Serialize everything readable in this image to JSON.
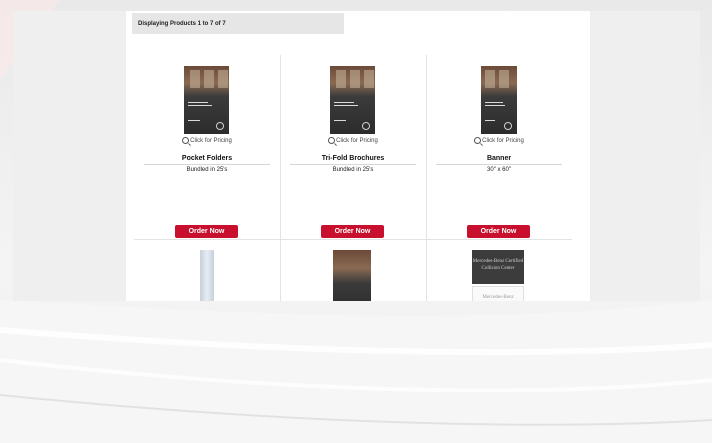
{
  "header": {
    "displaying_text": "Displaying Products 1 to 7 of 7"
  },
  "products": [
    {
      "pricing_label": "Click for Pricing",
      "title": "Pocket Folders",
      "subtitle": "Bundled in 25's",
      "button_label": "Order Now"
    },
    {
      "pricing_label": "Click for Pricing",
      "title": "Tri-Fold Brochures",
      "subtitle": "Bundled in 25's",
      "button_label": "Order Now"
    },
    {
      "pricing_label": "Click for Pricing",
      "title": "Banner",
      "subtitle": "30\" x 60\"",
      "button_label": "Order Now"
    }
  ],
  "bottom_items": {
    "sign_top_text": "Mercedes-Benz Certified Collision Center",
    "sign_bottom_text": "Mercedes-Benz"
  },
  "colors": {
    "order_button": "#c8102e",
    "panel_background": "#ffffff",
    "header_background": "#e6e6e6"
  },
  "icons": {
    "pricing": "magnifier-icon",
    "brand": "star-logo-icon"
  }
}
